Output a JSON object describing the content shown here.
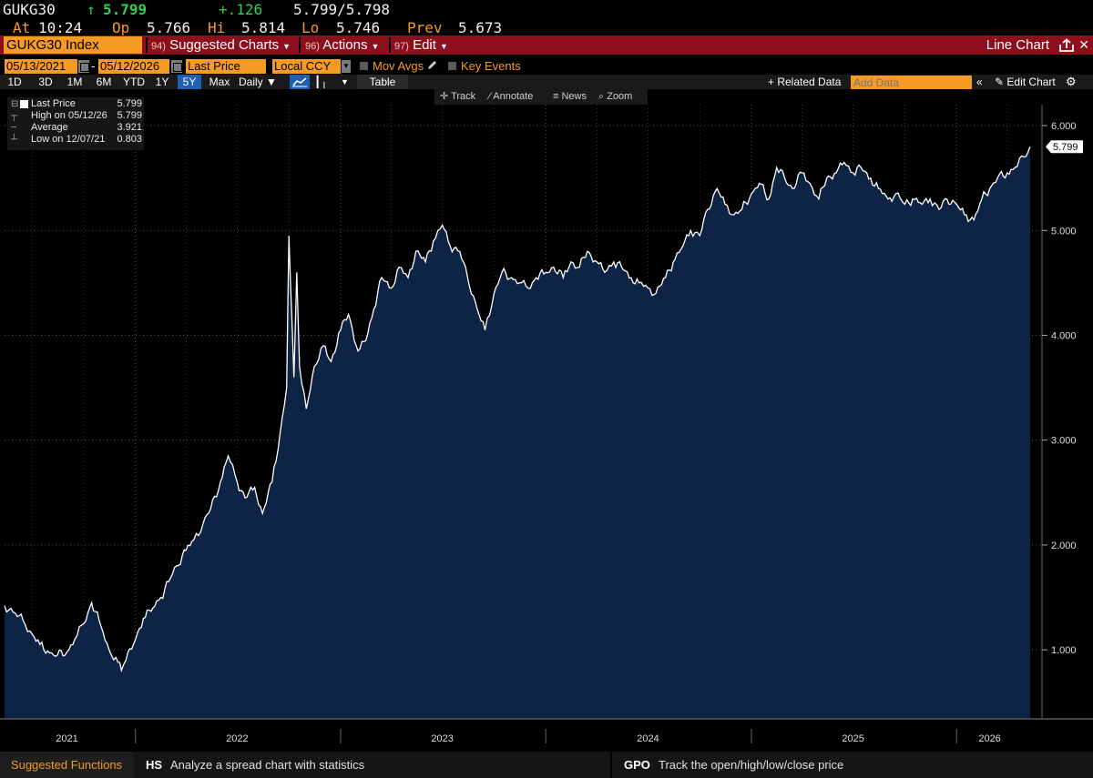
{
  "quote": {
    "ticker": "GUKG30",
    "arrow": "↑",
    "last": "5.799",
    "change": "+.126",
    "bid_ask": "5.799/5.798",
    "time_label": "At",
    "time": "10:24",
    "open_label": "Op",
    "open": "5.766",
    "high_label": "Hi",
    "high": "5.814",
    "low_label": "Lo",
    "low": "5.746",
    "prev_label": "Prev",
    "prev": "5.673"
  },
  "menubar": {
    "security": "GUKG30 Index",
    "suggested_num": "94)",
    "suggested_label": "Suggested Charts",
    "actions_num": "96)",
    "actions_label": "Actions",
    "edit_num": "97)",
    "edit_label": "Edit",
    "chart_type": "Line Chart"
  },
  "controls": {
    "start_date": "05/13/2021",
    "end_date": "05/12/2026",
    "field": "Last Price",
    "currency": "Local CCY",
    "mov_avgs": "Mov Avgs",
    "key_events": "Key Events",
    "ranges": [
      "1D",
      "3D",
      "1M",
      "6M",
      "YTD",
      "1Y",
      "5Y",
      "Max"
    ],
    "active_range": "5Y",
    "frequency": "Daily",
    "table_label": "Table",
    "related_label": "Related Data",
    "add_data_placeholder": "Add Data",
    "edit_chart_label": "Edit Chart"
  },
  "chart_tools": {
    "track": "Track",
    "annotate": "Annotate",
    "news": "News",
    "zoom": "Zoom"
  },
  "legend": {
    "last_label": "Last Price",
    "last_value": "5.799",
    "high_label": "High on 05/12/26",
    "high_value": "5.799",
    "avg_label": "Average",
    "avg_value": "3.921",
    "low_label": "Low on 12/07/21",
    "low_value": "0.803"
  },
  "chart_data": {
    "type": "area",
    "title": "",
    "xlabel": "",
    "ylabel": "",
    "ylim": [
      0.35,
      6.2
    ],
    "yticks": [
      "1.000",
      "2.000",
      "3.000",
      "4.000",
      "5.000",
      "6.000"
    ],
    "xticks": [
      "2021",
      "2022",
      "2023",
      "2024",
      "2025",
      "2026"
    ],
    "last_value_label": "5.799",
    "line_color": "#ffffff",
    "fill_color": "#0d2446",
    "grid": true,
    "series": [
      {
        "x": [
          "2021-05-13",
          "2021-06-01",
          "2021-06-15",
          "2021-07-01",
          "2021-07-15",
          "2021-08-01",
          "2021-08-15",
          "2021-09-01",
          "2021-09-15",
          "2021-10-01",
          "2021-10-15",
          "2021-11-01",
          "2021-11-15",
          "2021-12-01",
          "2021-12-07",
          "2021-12-15",
          "2022-01-01",
          "2022-01-15",
          "2022-02-01",
          "2022-02-15",
          "2022-03-01",
          "2022-03-15",
          "2022-04-01",
          "2022-04-15",
          "2022-05-01",
          "2022-05-15",
          "2022-06-01",
          "2022-06-15",
          "2022-07-01",
          "2022-07-15",
          "2022-08-01",
          "2022-08-15",
          "2022-09-01",
          "2022-09-15",
          "2022-09-27",
          "2022-10-01",
          "2022-10-10",
          "2022-10-15",
          "2022-10-20",
          "2022-11-01",
          "2022-11-15",
          "2022-12-01",
          "2022-12-15",
          "2023-01-01",
          "2023-01-15",
          "2023-02-01",
          "2023-02-15",
          "2023-03-01",
          "2023-03-15",
          "2023-04-01",
          "2023-04-15",
          "2023-05-01",
          "2023-05-15",
          "2023-06-01",
          "2023-06-15",
          "2023-07-01",
          "2023-07-15",
          "2023-08-01",
          "2023-08-15",
          "2023-09-01",
          "2023-09-15",
          "2023-10-01",
          "2023-10-15",
          "2023-11-01",
          "2023-11-15",
          "2023-12-01",
          "2023-12-15",
          "2024-01-01",
          "2024-01-15",
          "2024-02-01",
          "2024-02-15",
          "2024-03-01",
          "2024-03-15",
          "2024-04-01",
          "2024-04-15",
          "2024-05-01",
          "2024-05-15",
          "2024-06-01",
          "2024-06-15",
          "2024-07-01",
          "2024-07-15",
          "2024-08-01",
          "2024-08-15",
          "2024-09-01",
          "2024-09-15",
          "2024-10-01",
          "2024-10-15",
          "2024-11-01",
          "2024-11-15",
          "2024-12-01",
          "2024-12-15",
          "2025-01-01",
          "2025-01-15",
          "2025-02-01",
          "2025-02-15",
          "2025-03-01",
          "2025-03-15",
          "2025-04-01",
          "2025-04-15",
          "2025-05-01",
          "2025-05-15",
          "2025-06-01",
          "2025-06-15",
          "2025-07-01",
          "2025-07-15",
          "2025-08-01",
          "2025-08-15",
          "2025-09-01",
          "2025-09-15",
          "2025-10-01",
          "2025-10-15",
          "2025-11-01",
          "2025-11-15",
          "2025-12-01",
          "2025-12-15",
          "2026-01-01",
          "2026-01-15",
          "2026-02-01",
          "2026-02-15",
          "2026-03-01",
          "2026-03-15",
          "2026-04-01",
          "2026-04-15",
          "2026-05-01",
          "2026-05-12"
        ],
        "y": [
          1.42,
          1.35,
          1.28,
          1.15,
          1.05,
          0.97,
          0.95,
          0.98,
          1.1,
          1.25,
          1.45,
          1.22,
          1.0,
          0.88,
          0.803,
          0.9,
          1.1,
          1.3,
          1.4,
          1.5,
          1.65,
          1.8,
          1.95,
          2.05,
          2.2,
          2.35,
          2.6,
          2.85,
          2.6,
          2.45,
          2.55,
          2.3,
          2.6,
          3.05,
          3.5,
          4.95,
          3.6,
          4.6,
          3.7,
          3.3,
          3.7,
          3.9,
          3.75,
          4.05,
          4.2,
          3.85,
          3.95,
          4.25,
          4.55,
          4.45,
          4.65,
          4.55,
          4.8,
          4.7,
          4.9,
          5.05,
          4.85,
          4.8,
          4.55,
          4.25,
          4.05,
          4.4,
          4.6,
          4.55,
          4.5,
          4.45,
          4.55,
          4.6,
          4.65,
          4.55,
          4.7,
          4.65,
          4.8,
          4.7,
          4.6,
          4.7,
          4.65,
          4.55,
          4.5,
          4.45,
          4.4,
          4.55,
          4.7,
          4.85,
          5.0,
          4.95,
          5.2,
          5.4,
          5.25,
          5.15,
          5.2,
          5.35,
          5.45,
          5.3,
          5.6,
          5.5,
          5.4,
          5.55,
          5.45,
          5.3,
          5.5,
          5.55,
          5.65,
          5.55,
          5.6,
          5.5,
          5.4,
          5.3,
          5.35,
          5.25,
          5.3,
          5.25,
          5.3,
          5.2,
          5.3,
          5.25,
          5.15,
          5.1,
          5.3,
          5.4,
          5.5,
          5.55,
          5.6,
          5.7,
          5.799
        ]
      }
    ]
  },
  "bottom": {
    "suggested_functions": "Suggested Functions",
    "fn1_code": "HS",
    "fn1_desc": "Analyze a spread chart with statistics",
    "fn2_code": "GPO",
    "fn2_desc": "Track the open/high/low/close price"
  }
}
